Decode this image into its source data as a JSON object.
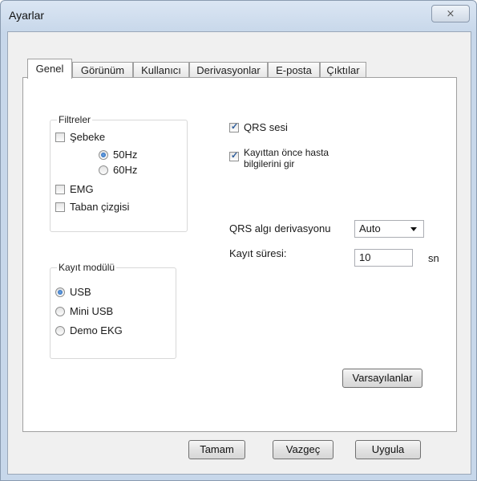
{
  "window": {
    "title": "Ayarlar",
    "close_glyph": "⨯",
    "close_icon": "close-icon"
  },
  "tabs": [
    {
      "label": "Genel",
      "active": true
    },
    {
      "label": "Görünüm",
      "active": false
    },
    {
      "label": "Kullanıcı",
      "active": false
    },
    {
      "label": "Derivasyonlar",
      "active": false
    },
    {
      "label": "E-posta",
      "active": false
    },
    {
      "label": "Çıktılar",
      "active": false
    }
  ],
  "filters": {
    "title": "Filtreler",
    "sebeke": {
      "label": "Şebeke",
      "checked": false
    },
    "hz50": {
      "label": "50Hz",
      "selected": true
    },
    "hz60": {
      "label": "60Hz",
      "selected": false
    },
    "emg": {
      "label": "EMG",
      "checked": false
    },
    "baseline": {
      "label": "Taban çizgisi",
      "checked": false
    }
  },
  "options": {
    "qrs_sound": {
      "label": "QRS sesi",
      "checked": true
    },
    "patient_info": {
      "label_line1": "Kayıttan önce hasta",
      "label_line2": "bilgilerini gir",
      "checked": true
    }
  },
  "qrs_lead": {
    "label": "QRS algı derivasyonu",
    "value": "Auto"
  },
  "record_duration": {
    "label": "Kayıt süresi:",
    "value": "10",
    "unit": "sn"
  },
  "recording_module": {
    "title": "Kayıt modülü",
    "usb": {
      "label": "USB",
      "selected": true
    },
    "mini_usb": {
      "label": "Mini USB",
      "selected": false
    },
    "demo": {
      "label": "Demo EKG",
      "selected": false
    }
  },
  "buttons": {
    "defaults": "Varsayılanlar",
    "ok": "Tamam",
    "cancel": "Vazgeç",
    "apply": "Uygula"
  }
}
